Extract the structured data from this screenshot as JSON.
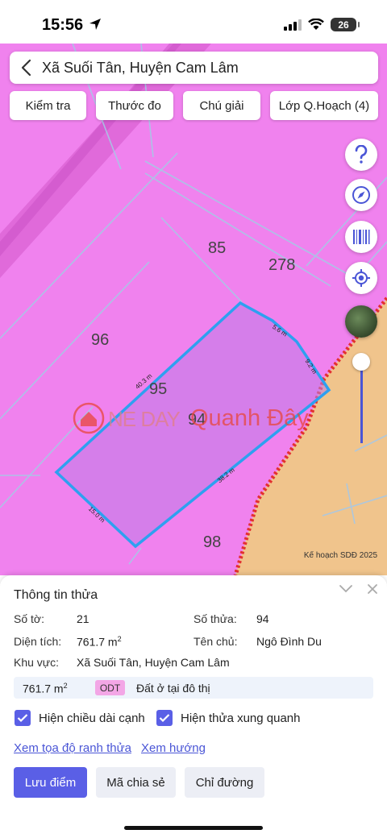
{
  "status_bar": {
    "time": "15:56",
    "battery": "26"
  },
  "header": {
    "title": "Xã Suối Tân, Huyện Cam Lâm"
  },
  "toolbar": {
    "check": "Kiểm tra",
    "measure": "Thước đo",
    "legend": "Chú giải",
    "layers": "Lớp Q.Hoạch (4)"
  },
  "map": {
    "parcel_numbers": {
      "p85": "85",
      "p278": "278",
      "p96": "96",
      "p95": "95",
      "p94": "94",
      "p98": "98"
    },
    "edge_lengths": {
      "top_left": "40.3 m",
      "top_right_a": "5.6 m",
      "top_right_b": "9.2 m",
      "bottom_right": "38.2 m",
      "bottom_left": "15.0 m"
    },
    "watermark": {
      "brand": "NE DAY",
      "name": "Quanh Đây"
    },
    "plan_caption": "Kế hoạch SDĐ 2025",
    "colors": {
      "residential": "#f082ee",
      "agricultural": "#f0c48c",
      "parcel_outline": "#2ea0f0",
      "boundary": "#e33030"
    },
    "icons": {
      "help": "question-icon",
      "compass": "compass-icon",
      "barcode": "barcode-icon",
      "locate": "locate-icon",
      "satellite": "satellite-thumbnail"
    },
    "layer_opacity_percent": 0
  },
  "panel": {
    "title": "Thông tin thửa",
    "so_to_label": "Số tờ:",
    "so_to_value": "21",
    "so_thua_label": "Số thửa:",
    "so_thua_value": "94",
    "dien_tich_label": "Diện tích:",
    "dien_tich_value": "761.7 m",
    "dien_tich_unit_sup": "2",
    "ten_chu_label": "Tên chủ:",
    "ten_chu_value": "Ngô Đình Du",
    "khu_vuc_label": "Khu vực:",
    "khu_vuc_value": "Xã Suối Tân, Huyện Cam Lâm",
    "zoning": {
      "area": "761.7 m",
      "area_sup": "2",
      "code": "ODT",
      "description": "Đất ở tại đô thị",
      "color": "#f3a6e6"
    },
    "checkbox_edges": "Hiện chiều dài cạnh",
    "checkbox_neighbors": "Hiện thửa xung quanh",
    "link_coords": "Xem tọa độ ranh thửa",
    "link_direction": "Xem hướng",
    "btn_save": "Lưu điểm",
    "btn_share": "Mã chia sẻ",
    "btn_directions": "Chỉ đường"
  }
}
